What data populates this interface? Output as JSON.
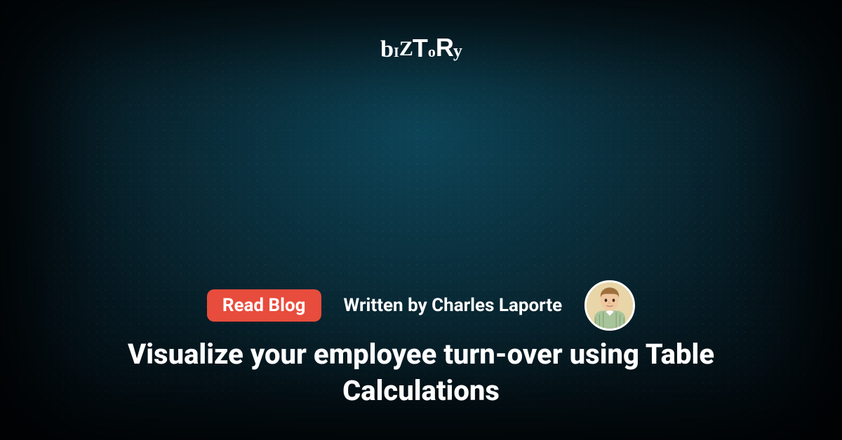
{
  "logo": {
    "text": "bIZToRy"
  },
  "cta": {
    "label": "Read Blog"
  },
  "byline": {
    "prefix": "Written by ",
    "author": "Charles Laporte"
  },
  "article": {
    "title": "Visualize your employee turn-over using Table Calculations"
  },
  "colors": {
    "accent": "#e74c3c",
    "text": "#ffffff"
  }
}
